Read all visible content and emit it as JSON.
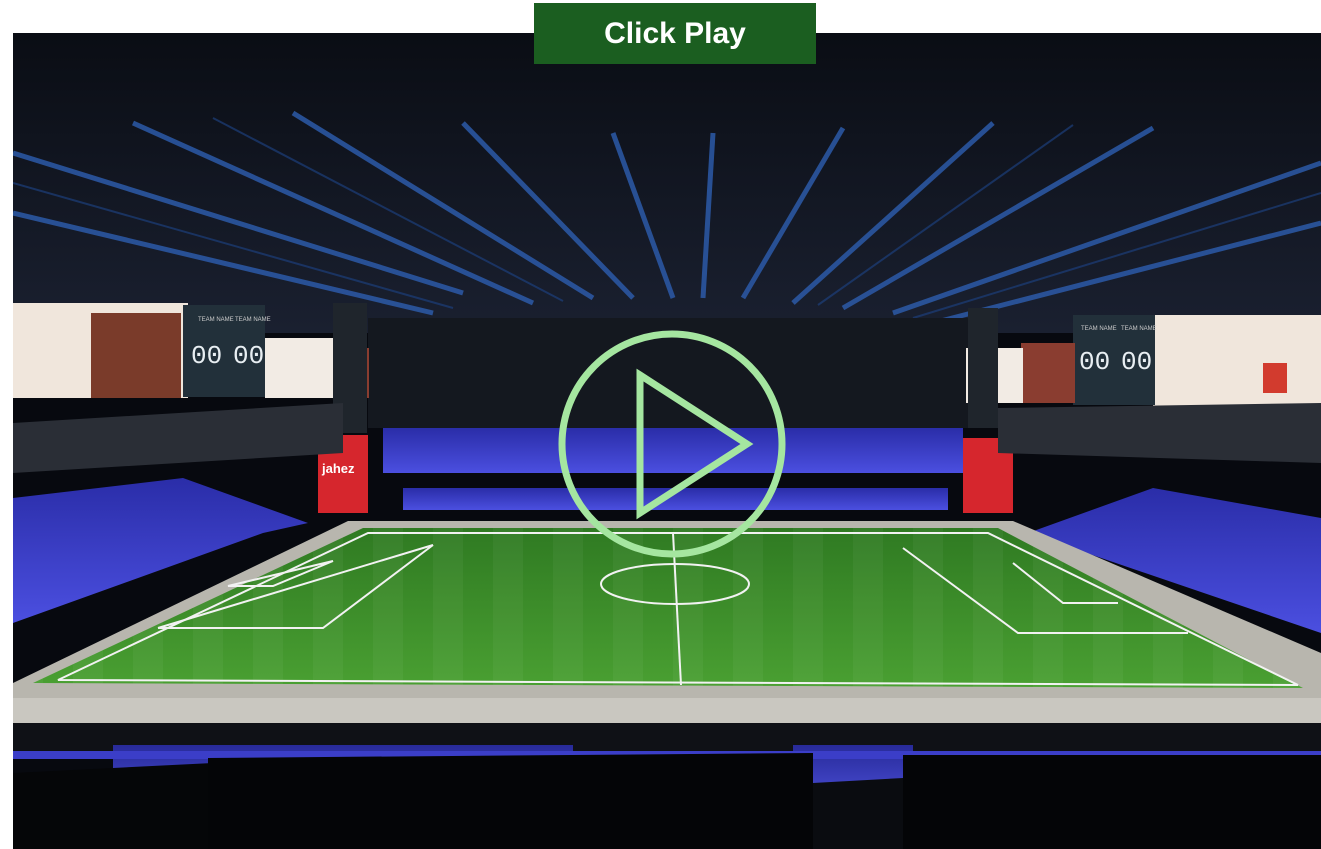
{
  "banner": {
    "label": "Click Play"
  },
  "scoreboards": {
    "left": {
      "home_label": "TEAM NAME",
      "away_label": "TEAM NAME",
      "home_score": "00",
      "away_score": "00"
    },
    "right": {
      "home_label": "TEAM NAME",
      "away_label": "TEAM NAME",
      "home_score": "00",
      "away_score": "00"
    }
  },
  "sponsor": {
    "name": "jahez"
  },
  "icons": {
    "play": "play-icon"
  },
  "colors": {
    "banner_bg": "#1b5e20",
    "play_ring": "#a5e6a0",
    "pitch": "#3f8f2a",
    "seats": "#3c3fd0"
  }
}
